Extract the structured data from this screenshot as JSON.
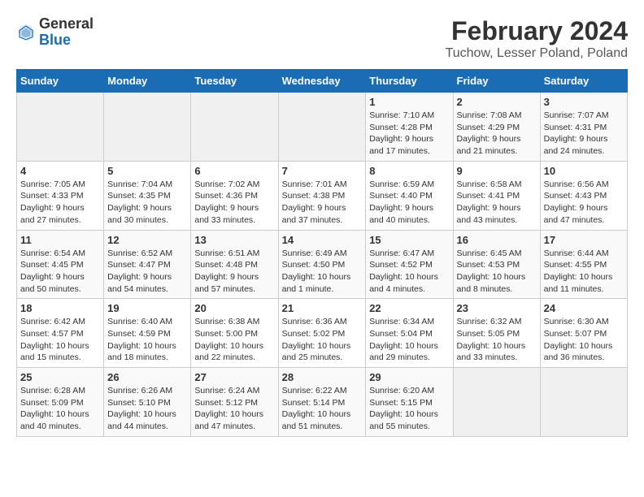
{
  "logo": {
    "general": "General",
    "blue": "Blue"
  },
  "title": "February 2024",
  "subtitle": "Tuchow, Lesser Poland, Poland",
  "days_of_week": [
    "Sunday",
    "Monday",
    "Tuesday",
    "Wednesday",
    "Thursday",
    "Friday",
    "Saturday"
  ],
  "weeks": [
    [
      {
        "day": "",
        "info": ""
      },
      {
        "day": "",
        "info": ""
      },
      {
        "day": "",
        "info": ""
      },
      {
        "day": "",
        "info": ""
      },
      {
        "day": "1",
        "info": "Sunrise: 7:10 AM\nSunset: 4:28 PM\nDaylight: 9 hours\nand 17 minutes."
      },
      {
        "day": "2",
        "info": "Sunrise: 7:08 AM\nSunset: 4:29 PM\nDaylight: 9 hours\nand 21 minutes."
      },
      {
        "day": "3",
        "info": "Sunrise: 7:07 AM\nSunset: 4:31 PM\nDaylight: 9 hours\nand 24 minutes."
      }
    ],
    [
      {
        "day": "4",
        "info": "Sunrise: 7:05 AM\nSunset: 4:33 PM\nDaylight: 9 hours\nand 27 minutes."
      },
      {
        "day": "5",
        "info": "Sunrise: 7:04 AM\nSunset: 4:35 PM\nDaylight: 9 hours\nand 30 minutes."
      },
      {
        "day": "6",
        "info": "Sunrise: 7:02 AM\nSunset: 4:36 PM\nDaylight: 9 hours\nand 33 minutes."
      },
      {
        "day": "7",
        "info": "Sunrise: 7:01 AM\nSunset: 4:38 PM\nDaylight: 9 hours\nand 37 minutes."
      },
      {
        "day": "8",
        "info": "Sunrise: 6:59 AM\nSunset: 4:40 PM\nDaylight: 9 hours\nand 40 minutes."
      },
      {
        "day": "9",
        "info": "Sunrise: 6:58 AM\nSunset: 4:41 PM\nDaylight: 9 hours\nand 43 minutes."
      },
      {
        "day": "10",
        "info": "Sunrise: 6:56 AM\nSunset: 4:43 PM\nDaylight: 9 hours\nand 47 minutes."
      }
    ],
    [
      {
        "day": "11",
        "info": "Sunrise: 6:54 AM\nSunset: 4:45 PM\nDaylight: 9 hours\nand 50 minutes."
      },
      {
        "day": "12",
        "info": "Sunrise: 6:52 AM\nSunset: 4:47 PM\nDaylight: 9 hours\nand 54 minutes."
      },
      {
        "day": "13",
        "info": "Sunrise: 6:51 AM\nSunset: 4:48 PM\nDaylight: 9 hours\nand 57 minutes."
      },
      {
        "day": "14",
        "info": "Sunrise: 6:49 AM\nSunset: 4:50 PM\nDaylight: 10 hours\nand 1 minute."
      },
      {
        "day": "15",
        "info": "Sunrise: 6:47 AM\nSunset: 4:52 PM\nDaylight: 10 hours\nand 4 minutes."
      },
      {
        "day": "16",
        "info": "Sunrise: 6:45 AM\nSunset: 4:53 PM\nDaylight: 10 hours\nand 8 minutes."
      },
      {
        "day": "17",
        "info": "Sunrise: 6:44 AM\nSunset: 4:55 PM\nDaylight: 10 hours\nand 11 minutes."
      }
    ],
    [
      {
        "day": "18",
        "info": "Sunrise: 6:42 AM\nSunset: 4:57 PM\nDaylight: 10 hours\nand 15 minutes."
      },
      {
        "day": "19",
        "info": "Sunrise: 6:40 AM\nSunset: 4:59 PM\nDaylight: 10 hours\nand 18 minutes."
      },
      {
        "day": "20",
        "info": "Sunrise: 6:38 AM\nSunset: 5:00 PM\nDaylight: 10 hours\nand 22 minutes."
      },
      {
        "day": "21",
        "info": "Sunrise: 6:36 AM\nSunset: 5:02 PM\nDaylight: 10 hours\nand 25 minutes."
      },
      {
        "day": "22",
        "info": "Sunrise: 6:34 AM\nSunset: 5:04 PM\nDaylight: 10 hours\nand 29 minutes."
      },
      {
        "day": "23",
        "info": "Sunrise: 6:32 AM\nSunset: 5:05 PM\nDaylight: 10 hours\nand 33 minutes."
      },
      {
        "day": "24",
        "info": "Sunrise: 6:30 AM\nSunset: 5:07 PM\nDaylight: 10 hours\nand 36 minutes."
      }
    ],
    [
      {
        "day": "25",
        "info": "Sunrise: 6:28 AM\nSunset: 5:09 PM\nDaylight: 10 hours\nand 40 minutes."
      },
      {
        "day": "26",
        "info": "Sunrise: 6:26 AM\nSunset: 5:10 PM\nDaylight: 10 hours\nand 44 minutes."
      },
      {
        "day": "27",
        "info": "Sunrise: 6:24 AM\nSunset: 5:12 PM\nDaylight: 10 hours\nand 47 minutes."
      },
      {
        "day": "28",
        "info": "Sunrise: 6:22 AM\nSunset: 5:14 PM\nDaylight: 10 hours\nand 51 minutes."
      },
      {
        "day": "29",
        "info": "Sunrise: 6:20 AM\nSunset: 5:15 PM\nDaylight: 10 hours\nand 55 minutes."
      },
      {
        "day": "",
        "info": ""
      },
      {
        "day": "",
        "info": ""
      }
    ]
  ]
}
